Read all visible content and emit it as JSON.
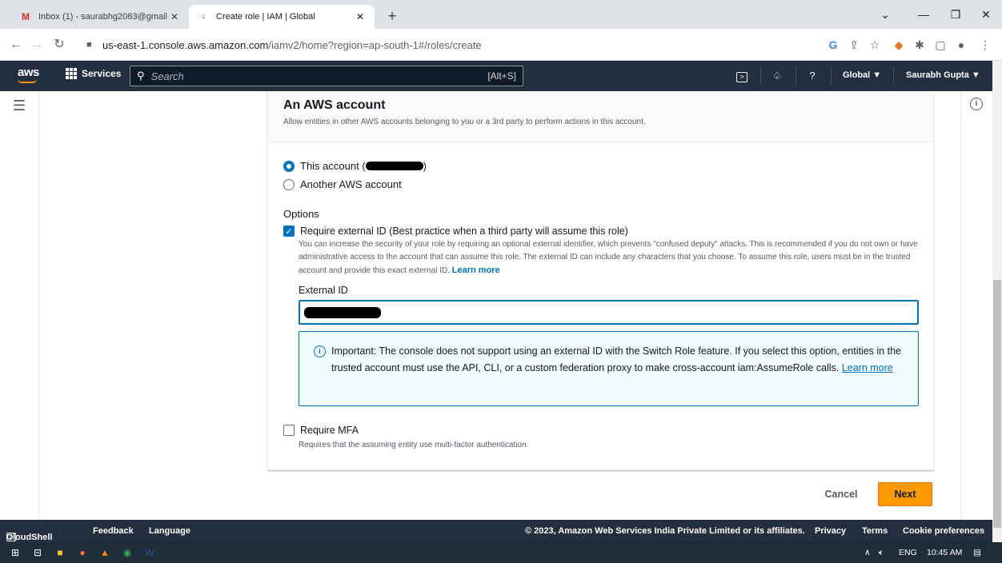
{
  "browser": {
    "tabs": [
      {
        "title": "Inbox (1) - saurabhg2083@gmail",
        "icon": "gmail-icon"
      },
      {
        "title": "Create role | IAM | Global",
        "icon": "iam-key-icon"
      }
    ],
    "url_host": "us-east-1.console.aws.amazon.com",
    "url_path": "/iamv2/home?region=ap-south-1#/roles/create"
  },
  "aws_nav": {
    "logo": "aws",
    "services_label": "Services",
    "search_placeholder": "Search",
    "search_shortcut": "[Alt+S]",
    "region": "Global ▼",
    "user": "Saurabh Gupta ▼"
  },
  "card": {
    "title": "An AWS account",
    "description": "Allow entities in other AWS accounts belonging to you or a 3rd party to perform actions in this account.",
    "radio_this_account": "This account (",
    "radio_this_account_close": ")",
    "radio_another_account": "Another AWS account",
    "options_label": "Options",
    "require_external_id_label": "Require external ID (Best practice when a third party will assume this role)",
    "require_external_id_help": "You can increase the security of your role by requiring an optional external identifier, which prevents \"confused deputy\" attacks. This is recommended if you do not own or have administrative access to the account that can assume this role. The external ID can include any characters that you choose. To assume this role, users must be in the trusted account and provide this exact external ID.",
    "learn_more": "Learn more",
    "external_id_label": "External ID",
    "info_text": "Important: The console does not support using an external ID with the Switch Role feature. If you select this option, entities in the trusted account must use the API, CLI, or a custom federation proxy to make cross-account iam:AssumeRole calls.",
    "info_learn_more": "Learn more",
    "require_mfa_label": "Require MFA",
    "require_mfa_help": "Requires that the assuming entity use multi-factor authentication.",
    "this_account_selected": true,
    "require_external_id_checked": true,
    "require_mfa_checked": false
  },
  "actions": {
    "cancel": "Cancel",
    "next": "Next"
  },
  "footer": {
    "cloudshell": "CloudShell",
    "feedback": "Feedback",
    "language": "Language",
    "copyright": "© 2023, Amazon Web Services India Private Limited or its affiliates.",
    "privacy": "Privacy",
    "terms": "Terms",
    "cookie": "Cookie preferences"
  },
  "taskbar": {
    "lang": "ENG",
    "time": "10:45 AM"
  },
  "colors": {
    "aws_nav_bg": "#232f3e",
    "accent_blue": "#0073bb",
    "primary_orange": "#ff9900"
  }
}
